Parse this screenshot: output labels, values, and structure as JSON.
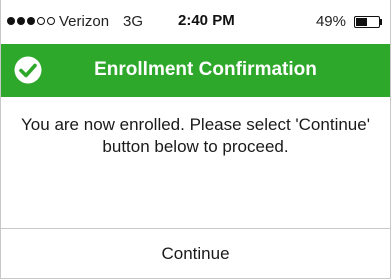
{
  "status_bar": {
    "signal_bars": 5,
    "signal_strength": 3,
    "carrier": "Verizon",
    "network": "3G",
    "time": "2:40 PM",
    "battery_percent": "49%",
    "battery_level": 0.49
  },
  "header": {
    "title": "Enrollment Confirmation",
    "icon": "check-circle-icon",
    "background_color": "#2da82a"
  },
  "message": {
    "text": "You are now enrolled.  Please select 'Continue' button below to proceed."
  },
  "actions": {
    "continue_label": "Continue"
  }
}
